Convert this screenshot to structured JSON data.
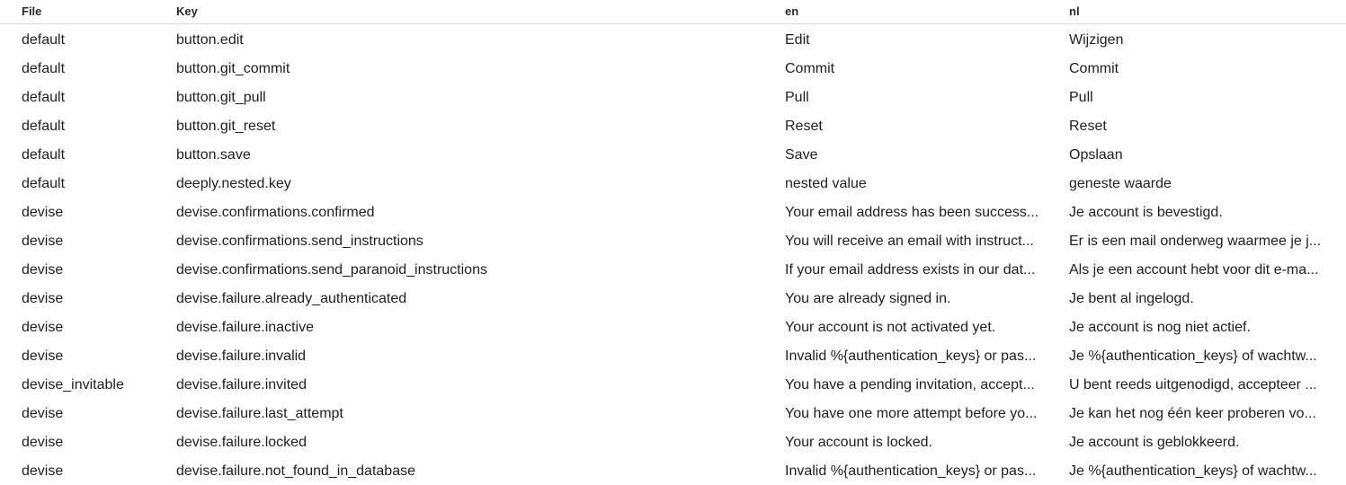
{
  "table": {
    "headers": {
      "file": "File",
      "key": "Key",
      "en": "en",
      "nl": "nl"
    },
    "rows": [
      {
        "file": "default",
        "key": "button.edit",
        "en": "Edit",
        "nl": "Wijzigen"
      },
      {
        "file": "default",
        "key": "button.git_commit",
        "en": "Commit",
        "nl": "Commit"
      },
      {
        "file": "default",
        "key": "button.git_pull",
        "en": "Pull",
        "nl": "Pull"
      },
      {
        "file": "default",
        "key": "button.git_reset",
        "en": "Reset",
        "nl": "Reset"
      },
      {
        "file": "default",
        "key": "button.save",
        "en": "Save",
        "nl": "Opslaan"
      },
      {
        "file": "default",
        "key": "deeply.nested.key",
        "en": "nested value",
        "nl": "geneste waarde"
      },
      {
        "file": "devise",
        "key": "devise.confirmations.confirmed",
        "en": "Your email address has been success...",
        "nl": "Je account is bevestigd."
      },
      {
        "file": "devise",
        "key": "devise.confirmations.send_instructions",
        "en": "You will receive an email with instruct...",
        "nl": "Er is een mail onderweg waarmee je j..."
      },
      {
        "file": "devise",
        "key": "devise.confirmations.send_paranoid_instructions",
        "en": "If your email address exists in our dat...",
        "nl": "Als je een account hebt voor dit e-ma..."
      },
      {
        "file": "devise",
        "key": "devise.failure.already_authenticated",
        "en": "You are already signed in.",
        "nl": "Je bent al ingelogd."
      },
      {
        "file": "devise",
        "key": "devise.failure.inactive",
        "en": "Your account is not activated yet.",
        "nl": "Je account is nog niet actief."
      },
      {
        "file": "devise",
        "key": "devise.failure.invalid",
        "en": "Invalid %{authentication_keys} or pas...",
        "nl": "Je %{authentication_keys} of wachtw..."
      },
      {
        "file": "devise_invitable",
        "key": "devise.failure.invited",
        "en": "You have a pending invitation, accept...",
        "nl": "U bent reeds uitgenodigd, accepteer ..."
      },
      {
        "file": "devise",
        "key": "devise.failure.last_attempt",
        "en": "You have one more attempt before yo...",
        "nl": "Je kan het nog één keer proberen vo..."
      },
      {
        "file": "devise",
        "key": "devise.failure.locked",
        "en": "Your account is locked.",
        "nl": "Je account is geblokkeerd."
      },
      {
        "file": "devise",
        "key": "devise.failure.not_found_in_database",
        "en": "Invalid %{authentication_keys} or pas...",
        "nl": "Je %{authentication_keys} of wachtw..."
      }
    ]
  }
}
